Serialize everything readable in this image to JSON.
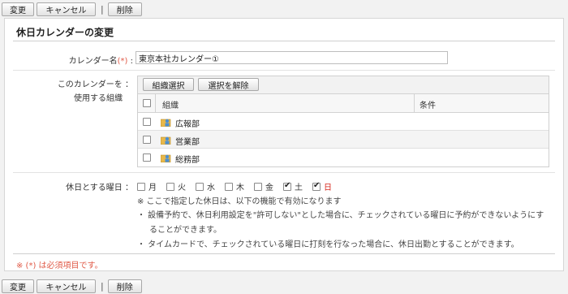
{
  "toolbar": {
    "change_label": "変更",
    "cancel_label": "キャンセル",
    "separator": "|",
    "delete_label": "削除"
  },
  "panel": {
    "title": "休日カレンダーの変更"
  },
  "calendar_name": {
    "label": "カレンダー名",
    "required_mark": "(*)",
    "colon": ":",
    "value": "東京本社カレンダー①"
  },
  "org": {
    "label_line1": "このカレンダーを ：",
    "label_line2": "使用する組織",
    "select_button": "組織選択",
    "clear_button": "選択を解除",
    "col_org": "組織",
    "col_condition": "条件",
    "rows": [
      {
        "name": "広報部"
      },
      {
        "name": "営業部"
      },
      {
        "name": "総務部"
      }
    ]
  },
  "holiday": {
    "label": "休日とする曜日 ：",
    "days": [
      {
        "label": "月",
        "checked": false,
        "red": false
      },
      {
        "label": "火",
        "checked": false,
        "red": false
      },
      {
        "label": "水",
        "checked": false,
        "red": false
      },
      {
        "label": "木",
        "checked": false,
        "red": false
      },
      {
        "label": "金",
        "checked": false,
        "red": false
      },
      {
        "label": "土",
        "checked": true,
        "red": false
      },
      {
        "label": "日",
        "checked": true,
        "red": true
      }
    ],
    "note_main": "※ ここで指定した休日は、以下の機能で有効になります",
    "note_b1_line1": "・ 設備予約で、休日利用設定を\"許可しない\"とした場合に、チェックされている曜日に予約ができないようにす",
    "note_b1_line2": "ることができます。",
    "note_b2": "・ タイムカードで、チェックされている曜日に打刻を行なった場合に、休日出勤とすることができます。"
  },
  "footer": {
    "required_note": "※ (*) は必須項目です。"
  }
}
